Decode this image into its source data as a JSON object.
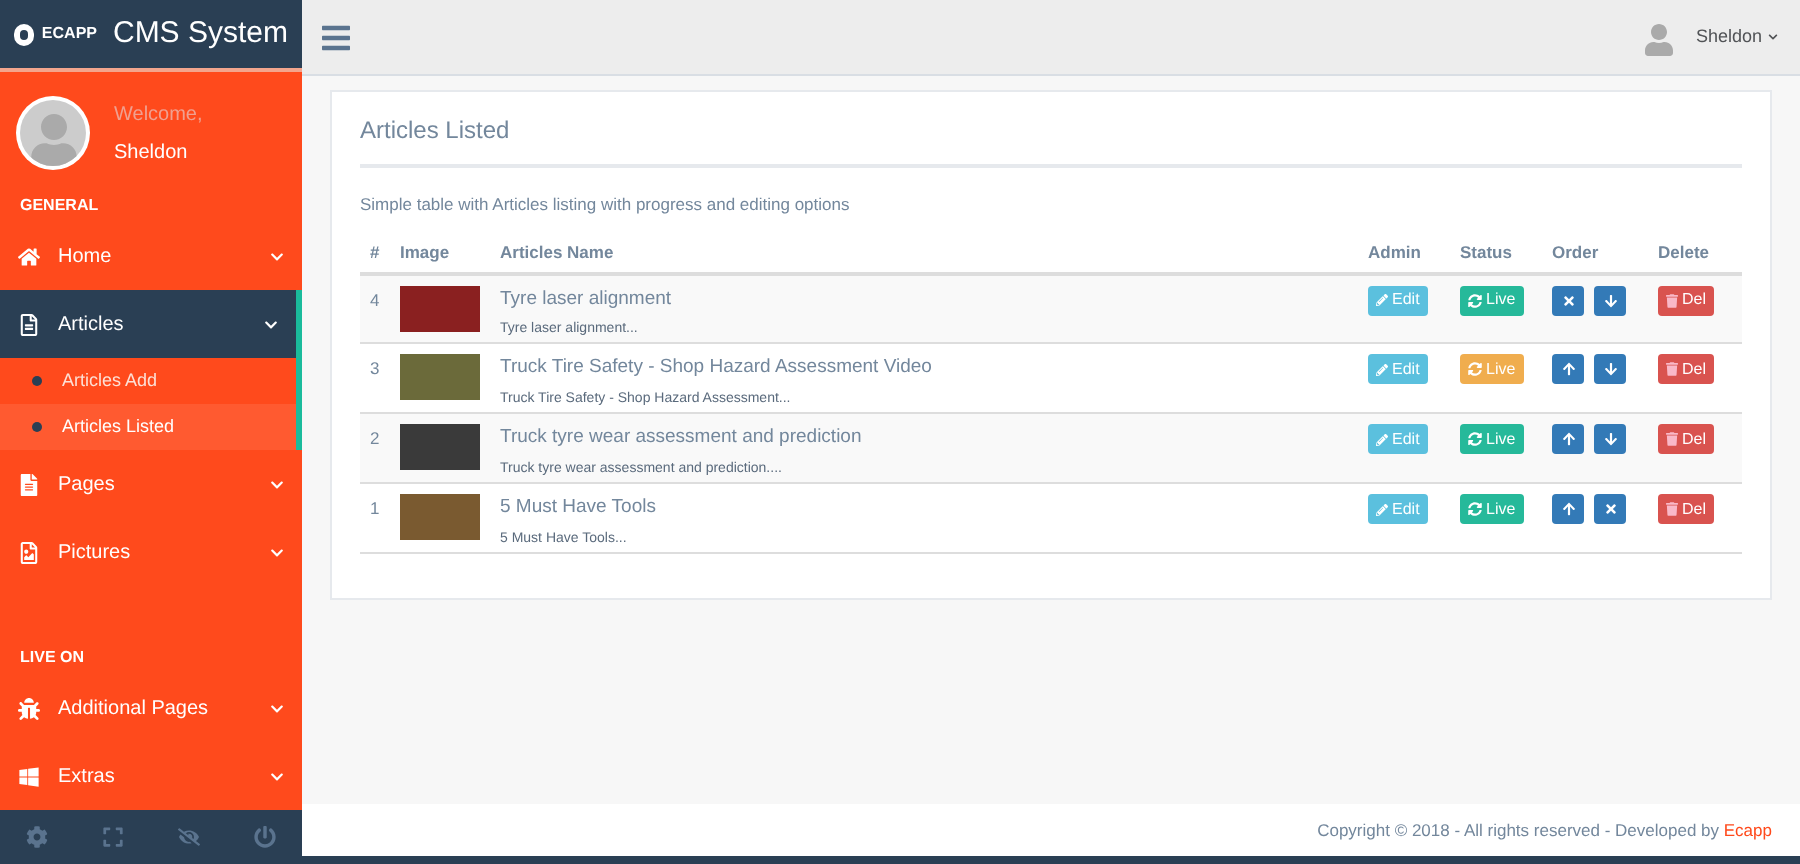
{
  "brand": {
    "logo_text": "ECAPP",
    "title": "CMS System"
  },
  "profile": {
    "greeting": "Welcome,",
    "name": "Sheldon"
  },
  "sidebar_sections": [
    {
      "heading": "GENERAL",
      "items": [
        {
          "label": "Home",
          "kind": "home",
          "expanded": false
        },
        {
          "label": "Articles",
          "kind": "file",
          "expanded": true,
          "children": [
            {
              "label": "Articles Add",
              "selected": false
            },
            {
              "label": "Articles Listed",
              "selected": true
            }
          ]
        },
        {
          "label": "Pages",
          "kind": "page",
          "expanded": false
        },
        {
          "label": "Pictures",
          "kind": "picture",
          "expanded": false
        }
      ]
    },
    {
      "heading": "LIVE ON",
      "items": [
        {
          "label": "Additional Pages",
          "kind": "bug",
          "expanded": false
        },
        {
          "label": "Extras",
          "kind": "windows",
          "expanded": false
        }
      ]
    }
  ],
  "topbar": {
    "user": "Sheldon"
  },
  "panel": {
    "title": "Articles Listed",
    "description": "Simple table with Articles listing with progress and editing options",
    "columns": [
      "#",
      "Image",
      "Articles Name",
      "Admin",
      "Status",
      "Order",
      "Delete"
    ],
    "rows": [
      {
        "num": "4",
        "title": "Tyre laser alignment",
        "summary": "Tyre laser alignment...",
        "edit": "Edit",
        "status": {
          "label": "Live",
          "color": "#26b99a"
        },
        "order": [
          {
            "kind": "remove"
          },
          {
            "kind": "down"
          }
        ],
        "delete": "Del"
      },
      {
        "num": "3",
        "title": "Truck Tire Safety - Shop Hazard Assessment Video",
        "summary": "Truck Tire Safety - Shop Hazard Assessment...",
        "edit": "Edit",
        "status": {
          "label": "Live",
          "color": "#f0ad4e"
        },
        "order": [
          {
            "kind": "up"
          },
          {
            "kind": "down"
          }
        ],
        "delete": "Del"
      },
      {
        "num": "2",
        "title": "Truck tyre wear assessment and prediction",
        "summary": "Truck tyre wear assessment and prediction....",
        "edit": "Edit",
        "status": {
          "label": "Live",
          "color": "#26b99a"
        },
        "order": [
          {
            "kind": "up"
          },
          {
            "kind": "down"
          }
        ],
        "delete": "Del"
      },
      {
        "num": "1",
        "title": "5 Must Have Tools",
        "summary": "5 Must Have Tools...",
        "edit": "Edit",
        "status": {
          "label": "Live",
          "color": "#26b99a"
        },
        "order": [
          {
            "kind": "up"
          },
          {
            "kind": "remove"
          }
        ],
        "delete": "Del"
      }
    ]
  },
  "footer": {
    "text": "Copyright © 2018 - All rights reserved - Developed by",
    "link": "Ecapp"
  }
}
